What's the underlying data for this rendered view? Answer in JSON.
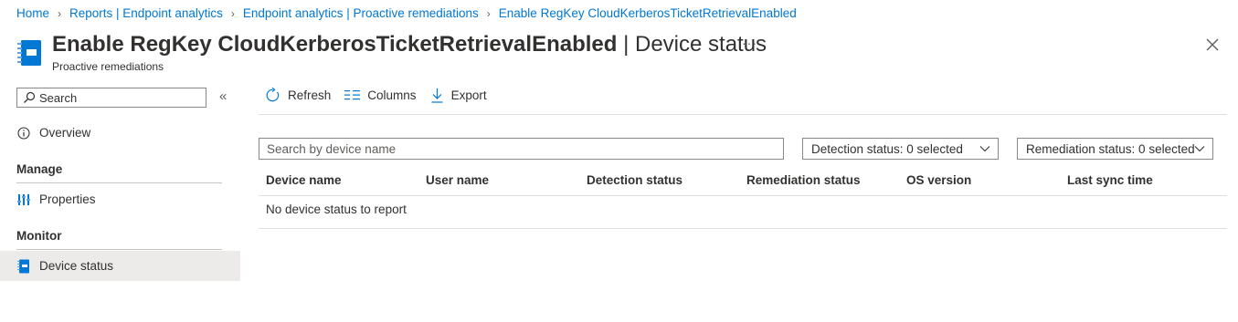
{
  "breadcrumb": [
    "Home",
    "Reports | Endpoint analytics",
    "Endpoint analytics | Proactive remediations",
    "Enable RegKey CloudKerberosTicketRetrievalEnabled"
  ],
  "header": {
    "title_main": "Enable RegKey CloudKerberosTicketRetrievalEnabled",
    "title_sep": " | ",
    "title_page": "Device status",
    "subtitle": "Proactive remediations",
    "more_label": "···",
    "icon": "script-icon",
    "close_icon": "close-icon"
  },
  "sidebar": {
    "search_placeholder": "Search",
    "collapse_label": "«",
    "overview": "Overview",
    "manage_label": "Manage",
    "properties": "Properties",
    "monitor_label": "Monitor",
    "device_status": "Device status"
  },
  "toolbar": {
    "refresh": "Refresh",
    "columns": "Columns",
    "export": "Export"
  },
  "filters": {
    "search_placeholder": "Search by device name",
    "detection": "Detection status: 0 selected",
    "remediation": "Remediation status: 0 selected"
  },
  "table": {
    "columns": [
      "Device name",
      "User name",
      "Detection status",
      "Remediation status",
      "OS version",
      "Last sync time"
    ],
    "empty_message": "No device status to report"
  },
  "colors": {
    "accent": "#0078d4",
    "text": "#323130",
    "selected_bg": "#edebe9"
  }
}
